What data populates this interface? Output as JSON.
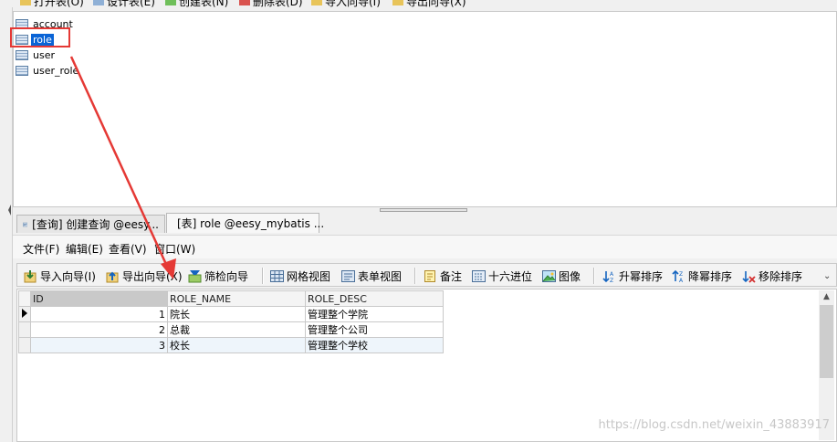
{
  "top_toolbar": {
    "buttons": [
      "打开表(O)",
      "设计表(E)",
      "创建表(N)",
      "删除表(D)",
      "导入向导(I)",
      "导出向导(X)"
    ]
  },
  "table_list": {
    "items": [
      "account",
      "role",
      "user",
      "user_role"
    ],
    "selected": "role"
  },
  "tabs": [
    {
      "label": "[查询] 创建查询 @eesy..."
    },
    {
      "label": "[表] role @eesy_mybatis ..."
    }
  ],
  "menu": {
    "items": [
      "文件(F)",
      "编辑(E)",
      "查看(V)",
      "窗口(W)"
    ]
  },
  "grid_toolbar": {
    "import": "导入向导(I)",
    "export": "导出向导(X)",
    "filter": "筛检向导",
    "grid_view": "网格视图",
    "form_view": "表单视图",
    "memo": "备注",
    "hex": "十六进位",
    "image": "图像",
    "sort_asc": "升幂排序",
    "sort_desc": "降幂排序",
    "remove_sort": "移除排序",
    "more": "⌄"
  },
  "grid": {
    "columns": [
      "ID",
      "ROLE_NAME",
      "ROLE_DESC"
    ],
    "rows": [
      [
        "1",
        "院长",
        "管理整个学院"
      ],
      [
        "2",
        "总裁",
        "管理整个公司"
      ],
      [
        "3",
        "校长",
        "管理整个学校"
      ]
    ]
  },
  "colors": {
    "annotation_red": "#e53935",
    "selection_blue": "#0a64d6"
  },
  "watermark": "https://blog.csdn.net/weixin_43883917"
}
